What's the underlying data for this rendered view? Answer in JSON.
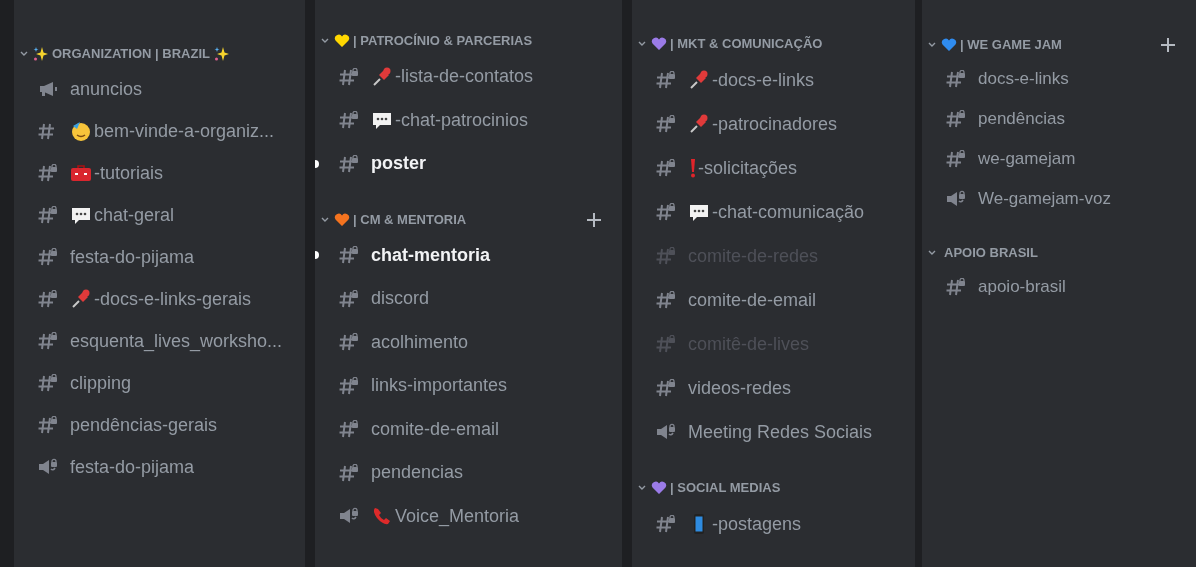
{
  "columns": [
    {
      "categories": [
        {
          "title": "ORGANIZATION | BRAZIL",
          "kind": "sparkles",
          "add_button": false,
          "channels": [
            {
              "name": "anuncios",
              "kind": "announcement",
              "unread": false,
              "muted": false
            },
            {
              "name": "bem-vinde-a-organiz...",
              "kind": "text",
              "emoji": {
                "kind": "party-face"
              },
              "unread": false,
              "muted": false
            },
            {
              "name": "-tutoriais",
              "kind": "locked-text",
              "emoji": {
                "kind": "toolbox"
              },
              "unread": false,
              "muted": false
            },
            {
              "name": "chat-geral",
              "kind": "locked-text",
              "emoji": {
                "kind": "speech"
              },
              "unread": false,
              "muted": false
            },
            {
              "name": "festa-do-pijama",
              "kind": "locked-text",
              "unread": false,
              "muted": false
            },
            {
              "name": "-docs-e-links-gerais",
              "kind": "locked-text",
              "emoji": {
                "kind": "pin"
              },
              "unread": false,
              "muted": false
            },
            {
              "name": "esquenta_lives_worksho...",
              "kind": "locked-text",
              "unread": false,
              "muted": false
            },
            {
              "name": "clipping",
              "kind": "locked-text",
              "unread": false,
              "muted": false
            },
            {
              "name": "pendências-gerais",
              "kind": "locked-text",
              "unread": false,
              "muted": false
            },
            {
              "name": "festa-do-pijama",
              "kind": "locked-voice",
              "unread": false,
              "muted": false
            }
          ]
        }
      ]
    },
    {
      "categories": [
        {
          "title": "| PATROCÍNIO & PARCERIAS",
          "kind": "heart",
          "color": "#ffd700",
          "add_button": false,
          "channels": [
            {
              "name": "-lista-de-contatos",
              "kind": "locked-text",
              "emoji": {
                "kind": "pin"
              },
              "unread": false,
              "muted": false
            },
            {
              "name": "-chat-patrocinios",
              "kind": "locked-text",
              "emoji": {
                "kind": "speech"
              },
              "unread": false,
              "muted": false
            },
            {
              "name": "poster",
              "kind": "locked-text",
              "unread": true,
              "muted": false
            }
          ]
        },
        {
          "title": "| CM & MENTORIA",
          "kind": "heart",
          "color": "#f4731f",
          "add_button": true,
          "channels": [
            {
              "name": "chat-mentoria",
              "kind": "locked-text",
              "unread": true,
              "muted": false
            },
            {
              "name": "discord",
              "kind": "locked-text",
              "unread": false,
              "muted": false
            },
            {
              "name": "acolhimento",
              "kind": "locked-text",
              "unread": false,
              "muted": false
            },
            {
              "name": "links-importantes",
              "kind": "locked-text",
              "unread": false,
              "muted": false
            },
            {
              "name": "comite-de-email",
              "kind": "locked-text",
              "unread": false,
              "muted": false
            },
            {
              "name": "pendencias",
              "kind": "locked-text",
              "unread": false,
              "muted": false
            },
            {
              "name": "Voice_Mentoria",
              "kind": "locked-voice",
              "emoji": {
                "kind": "phone"
              },
              "unread": false,
              "muted": false
            }
          ]
        }
      ]
    },
    {
      "categories": [
        {
          "title": "| MKT & COMUNICAÇÃO",
          "kind": "heart",
          "color": "#9b7be8",
          "add_button": false,
          "channels": [
            {
              "name": "-docs-e-links",
              "kind": "locked-text",
              "emoji": {
                "kind": "pin"
              },
              "unread": false,
              "muted": false
            },
            {
              "name": "-patrocinadores",
              "kind": "locked-text",
              "emoji": {
                "kind": "pin"
              },
              "unread": false,
              "muted": false
            },
            {
              "name": "-solicitações",
              "kind": "locked-text",
              "emoji": {
                "kind": "exclamation"
              },
              "unread": false,
              "muted": false
            },
            {
              "name": "-chat-comunicação",
              "kind": "locked-text",
              "emoji": {
                "kind": "speech"
              },
              "unread": false,
              "muted": false
            },
            {
              "name": "comite-de-redes",
              "kind": "locked-text",
              "unread": false,
              "muted": true
            },
            {
              "name": "comite-de-email",
              "kind": "locked-text",
              "unread": false,
              "muted": false
            },
            {
              "name": "comitê-de-lives",
              "kind": "locked-text",
              "unread": false,
              "muted": true
            },
            {
              "name": "videos-redes",
              "kind": "locked-text",
              "unread": false,
              "muted": false
            },
            {
              "name": "Meeting Redes Sociais",
              "kind": "locked-voice",
              "unread": false,
              "muted": false
            }
          ]
        },
        {
          "title": "| SOCIAL MEDIAS",
          "kind": "heart",
          "color": "#9b7be8",
          "add_button": false,
          "channels": [
            {
              "name": "-postagens",
              "kind": "locked-text",
              "emoji": {
                "kind": "mobile"
              },
              "unread": false,
              "muted": false
            }
          ]
        }
      ]
    },
    {
      "categories": [
        {
          "title": "| WE GAME JAM",
          "kind": "heart",
          "color": "#2f8cf0",
          "add_button": true,
          "channels": [
            {
              "name": "docs-e-links",
              "kind": "locked-text",
              "unread": false,
              "muted": false
            },
            {
              "name": "pendências",
              "kind": "locked-text",
              "unread": false,
              "muted": false
            },
            {
              "name": "we-gamejam",
              "kind": "locked-text",
              "unread": false,
              "muted": false
            },
            {
              "name": "We-gamejam-voz",
              "kind": "locked-voice",
              "unread": false,
              "muted": false
            }
          ]
        },
        {
          "title": "APOIO BRASIL",
          "kind": "plain",
          "add_button": false,
          "channels": [
            {
              "name": "apoio-brasil",
              "kind": "locked-text",
              "unread": false,
              "muted": false
            }
          ]
        }
      ]
    }
  ]
}
